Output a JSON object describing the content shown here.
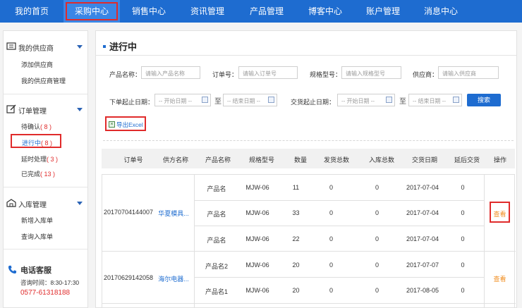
{
  "nav": {
    "items": [
      {
        "label": "我的首页",
        "active": false
      },
      {
        "label": "采购中心",
        "active": true
      },
      {
        "label": "销售中心",
        "active": false
      },
      {
        "label": "资讯管理",
        "active": false
      },
      {
        "label": "产品管理",
        "active": false
      },
      {
        "label": "博客中心",
        "active": false
      },
      {
        "label": "账户管理",
        "active": false
      },
      {
        "label": "消息中心",
        "active": false
      }
    ]
  },
  "sidebar": {
    "supplier": {
      "title": "我的供应商",
      "add": "添加供应商",
      "manage": "我的供应商管理"
    },
    "order": {
      "title": "订单管理",
      "pending": {
        "label": "待确认",
        "count": "( 8 )"
      },
      "in_progress": {
        "label": "进行中",
        "count": "( 8 )"
      },
      "delayed": {
        "label": "延时处理",
        "count": "( 3 )"
      },
      "done": {
        "label": "已完成",
        "count": "( 13 )"
      }
    },
    "storage": {
      "title": "入库管理",
      "add": "新增入库单",
      "query": "查询入库单"
    },
    "service": {
      "title": "电话客服",
      "time": "咨询时间：8:30-17:30",
      "phone": "0577-61318188"
    }
  },
  "main": {
    "title": "进行中",
    "filters": {
      "product_label": "产品名称：",
      "product_placeholder": "请输入产品名称",
      "order_label": "订单号：",
      "order_placeholder": "请输入订单号",
      "spec_label": "规格型号：",
      "spec_placeholder": "请输入规格型号",
      "supplier_label": "供应商：",
      "supplier_placeholder": "请输入供应商",
      "order_date_label": "下单起止日期：",
      "delivery_date_label": "交货起止日期：",
      "start_placeholder": "-- 开始日期 --",
      "end_placeholder": "-- 结束日期 --",
      "range_sep": "至",
      "search": "搜索"
    },
    "export": "导出Excel",
    "columns": [
      "订单号",
      "供方名称",
      "产品名称",
      "规格型号",
      "数量",
      "发货总数",
      "入库总数",
      "交货日期",
      "延后交货",
      "操作"
    ],
    "orders": [
      {
        "order_no": "20170704144007",
        "supplier": "华夏模具...",
        "action": "查看",
        "items": [
          {
            "product": "产品名",
            "spec": "MJW-06",
            "qty": "11",
            "shipped": "0",
            "stored": "0",
            "date": "2017-07-04",
            "delay": "0"
          },
          {
            "product": "产品名",
            "spec": "MJW-06",
            "qty": "33",
            "shipped": "0",
            "stored": "0",
            "date": "2017-07-04",
            "delay": "0"
          },
          {
            "product": "产品名",
            "spec": "MJW-06",
            "qty": "22",
            "shipped": "0",
            "stored": "0",
            "date": "2017-07-04",
            "delay": "0"
          }
        ]
      },
      {
        "order_no": "20170629142058",
        "supplier": "海尔电器...",
        "action": "查看",
        "items": [
          {
            "product": "产品名2",
            "spec": "MJW-06",
            "qty": "20",
            "shipped": "0",
            "stored": "0",
            "date": "2017-07-07",
            "delay": "0"
          },
          {
            "product": "产品名1",
            "spec": "MJW-06",
            "qty": "20",
            "shipped": "0",
            "stored": "0",
            "date": "2017-08-05",
            "delay": "0"
          }
        ]
      }
    ]
  }
}
